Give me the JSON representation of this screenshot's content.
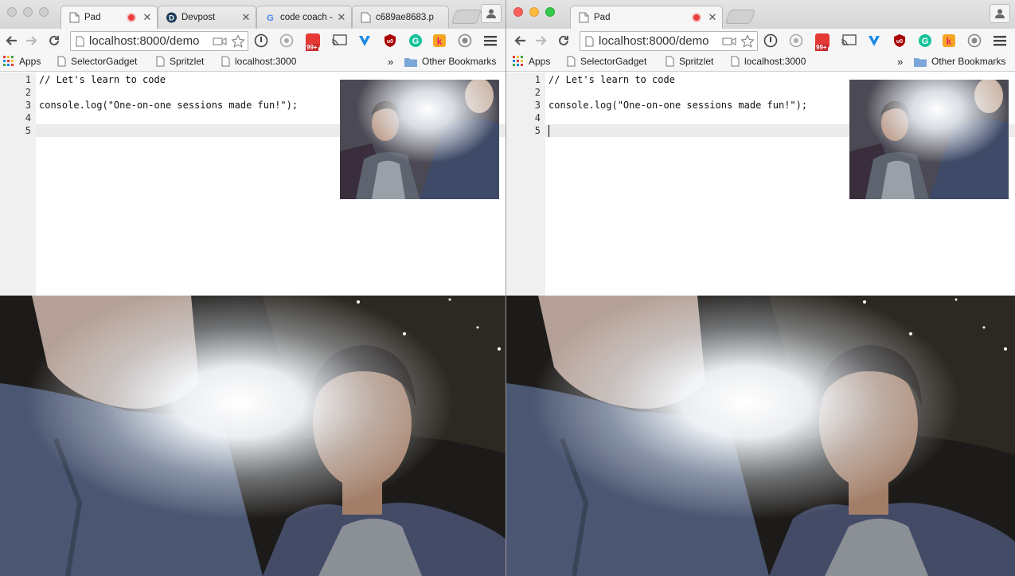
{
  "windows": [
    {
      "id": "left",
      "tabs": [
        {
          "title": "Pad",
          "recording": true
        },
        {
          "title": "Devpost"
        },
        {
          "title": "code coach -"
        },
        {
          "title": "c689ae8683.p"
        }
      ],
      "url": "localhost:8000/demo",
      "extension_badge": "99+",
      "bookmarks": [
        "Apps",
        "SelectorGadget",
        "Spritzlet",
        "localhost:3000"
      ],
      "bookmarks_overflow": "»",
      "other_bookmarks": "Other Bookmarks"
    },
    {
      "id": "right",
      "tabs": [
        {
          "title": "Pad",
          "recording": true
        }
      ],
      "url": "localhost:8000/demo",
      "extension_badge": "99+",
      "bookmarks": [
        "Apps",
        "SelectorGadget",
        "Spritzlet",
        "localhost:3000"
      ],
      "bookmarks_overflow": "»",
      "other_bookmarks": "Other Bookmarks"
    }
  ],
  "editor": {
    "lines": [
      {
        "num": "1",
        "code": "// Let's learn to code"
      },
      {
        "num": "2",
        "code": ""
      },
      {
        "num": "3",
        "code": "console.log(\"One-on-one sessions made fun!\");"
      },
      {
        "num": "4",
        "code": ""
      },
      {
        "num": "5",
        "code": ""
      }
    ],
    "active_line": 5
  },
  "icons": {
    "back": "arrow-left-icon",
    "forward": "arrow-right-icon",
    "reload": "reload-icon",
    "page": "page-icon",
    "camera": "camera-icon",
    "star": "star-icon",
    "menu": "hamburger-menu-icon",
    "folder": "folder-icon"
  },
  "colors": {
    "close": "#fc605b",
    "minimize": "#fdbc40",
    "zoom": "#34c84a",
    "recording": "#ea3d3d",
    "badge": "#e53935"
  }
}
